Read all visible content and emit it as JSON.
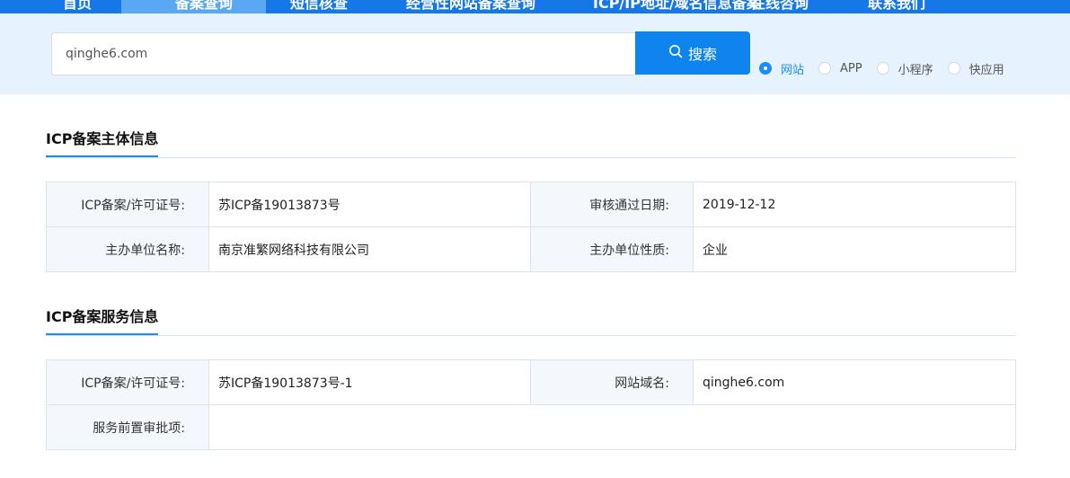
{
  "nav": {
    "items": [
      "首页",
      "备案查询",
      "短信核查",
      "经营性网站备案查询",
      "ICP/IP地址/域名信息备案",
      "在线咨询",
      "联系我们"
    ]
  },
  "search": {
    "value": "qinghe6.com",
    "button_label": "搜索",
    "types": [
      {
        "label": "网站",
        "checked": true
      },
      {
        "label": "APP",
        "checked": false
      },
      {
        "label": "小程序",
        "checked": false
      },
      {
        "label": "快应用",
        "checked": false
      }
    ]
  },
  "entity_section": {
    "title": "ICP备案主体信息",
    "license_label": "ICP备案/许可证号:",
    "license_value": "苏ICP备19013873号",
    "approve_date_label": "审核通过日期:",
    "approve_date_value": "2019-12-12",
    "org_name_label": "主办单位名称:",
    "org_name_value": "南京准繁网络科技有限公司",
    "org_type_label": "主办单位性质:",
    "org_type_value": "企业"
  },
  "service_section": {
    "title": "ICP备案服务信息",
    "license_label": "ICP备案/许可证号:",
    "license_value": "苏ICP备19013873号-1",
    "domain_label": "网站域名:",
    "domain_value": "qinghe6.com",
    "preapproval_label": "服务前置审批项:",
    "preapproval_value": ""
  },
  "colors": {
    "primary": "#0e84ef",
    "band": "#e6f2fd",
    "nav": "#1677e8"
  }
}
